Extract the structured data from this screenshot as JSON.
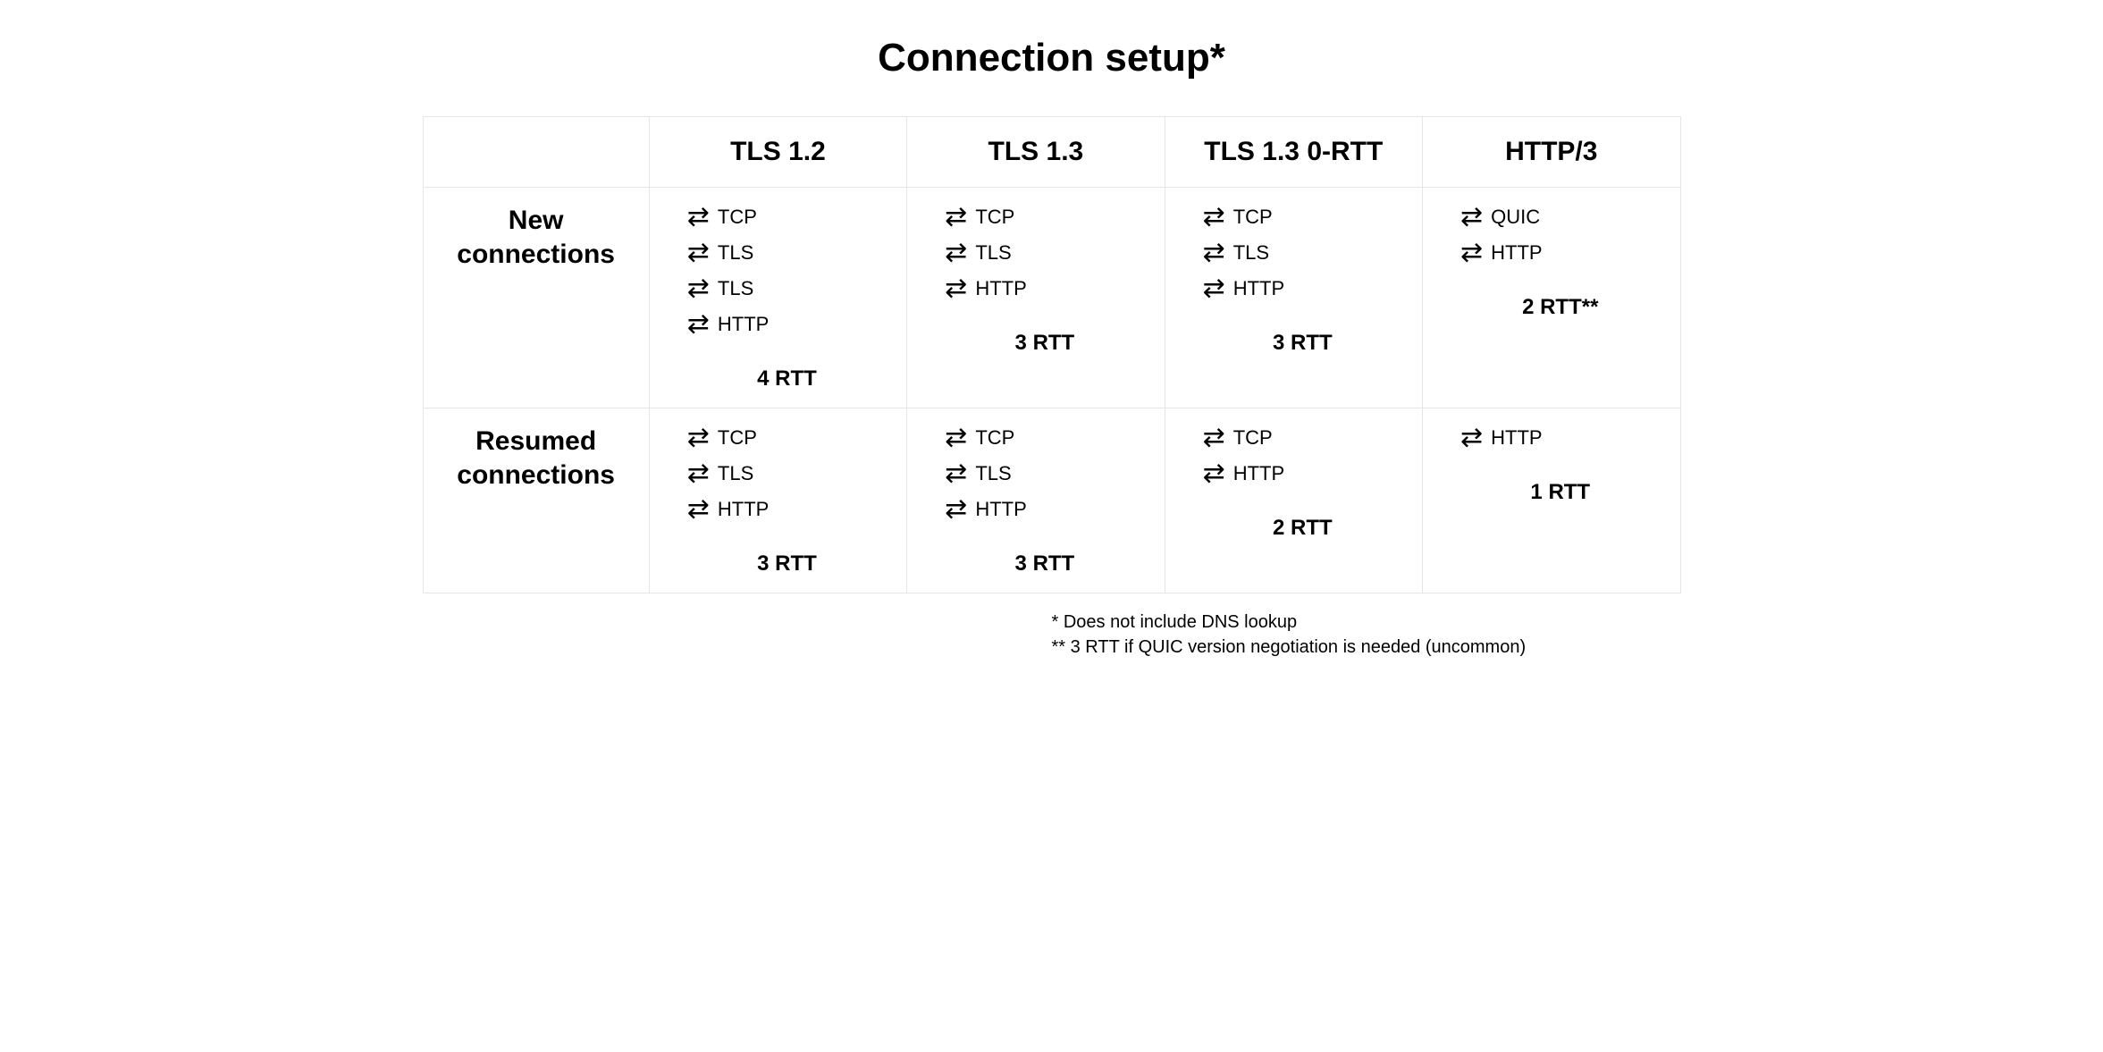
{
  "title": "Connection setup*",
  "columns": [
    "TLS 1.2",
    "TLS 1.3",
    "TLS 1.3 0-RTT",
    "HTTP/3"
  ],
  "rows": {
    "new": {
      "label": "New\nconnections",
      "cells": [
        {
          "steps": [
            "TCP",
            "TLS",
            "TLS",
            "HTTP"
          ],
          "rtt": "4 RTT"
        },
        {
          "steps": [
            "TCP",
            "TLS",
            "HTTP"
          ],
          "rtt": "3 RTT"
        },
        {
          "steps": [
            "TCP",
            "TLS",
            "HTTP"
          ],
          "rtt": "3 RTT"
        },
        {
          "steps": [
            "QUIC",
            "HTTP"
          ],
          "rtt": "2 RTT**"
        }
      ]
    },
    "resumed": {
      "label": "Resumed\nconnections",
      "cells": [
        {
          "steps": [
            "TCP",
            "TLS",
            "HTTP"
          ],
          "rtt": "3 RTT"
        },
        {
          "steps": [
            "TCP",
            "TLS",
            "HTTP"
          ],
          "rtt": "3 RTT"
        },
        {
          "steps": [
            "TCP",
            "HTTP"
          ],
          "rtt": "2 RTT"
        },
        {
          "steps": [
            "HTTP"
          ],
          "rtt": "1 RTT"
        }
      ]
    }
  },
  "footnotes": [
    "* Does not include DNS lookup",
    "** 3 RTT if QUIC version negotiation is needed (uncommon)"
  ],
  "arrow_glyph": "⇄"
}
